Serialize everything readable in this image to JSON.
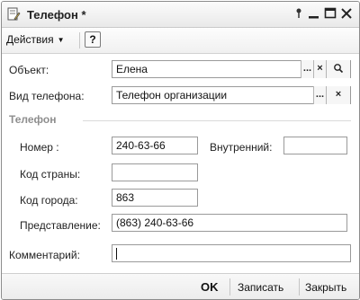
{
  "window": {
    "title": "Телефон *"
  },
  "toolbar": {
    "actions_label": "Действия",
    "help_label": "?"
  },
  "form": {
    "object_label": "Объект:",
    "object_value": "Елена",
    "phone_type_label": "Вид телефона:",
    "phone_type_value": "Телефон организации",
    "section_title": "Телефон",
    "number_label": "Номер :",
    "number_value": "240-63-66",
    "internal_label": "Внутренний:",
    "internal_value": "",
    "country_code_label": "Код страны:",
    "country_code_value": "",
    "city_code_label": "Код города:",
    "city_code_value": "863",
    "representation_label": "Представление:",
    "representation_value": "(863) 240-63-66",
    "comment_label": "Комментарий:",
    "comment_value": "",
    "select_button_label": "...",
    "clear_button_label": "×"
  },
  "footer": {
    "ok_label": "OK",
    "save_label": "Записать",
    "close_label": "Закрыть"
  },
  "colors": {
    "section_heading": "#8e8e8e",
    "field_border": "#9a9a9a",
    "window_border": "#8c8c8c"
  },
  "icons": [
    "document-edit-icon",
    "pin-icon",
    "minimize-icon",
    "maximize-icon",
    "close-icon",
    "search-icon"
  ]
}
